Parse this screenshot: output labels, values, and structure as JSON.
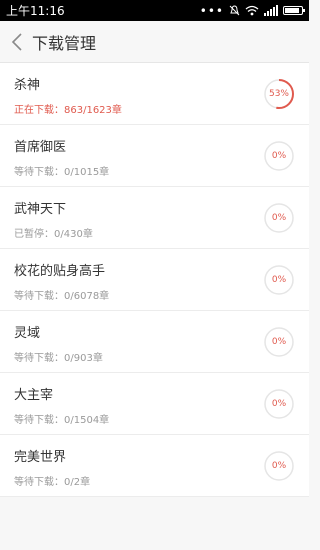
{
  "status_bar": {
    "time": "上午11:16",
    "icons": [
      "dots-icon",
      "mute-icon",
      "wifi-icon",
      "signal-icon",
      "battery-icon"
    ]
  },
  "header": {
    "back_icon": "chevron-left-icon",
    "title": "下载管理"
  },
  "downloads": [
    {
      "name": "杀神",
      "status": "正在下载：863/1623章",
      "percent": "53%",
      "progress": 0.53,
      "active": true
    },
    {
      "name": "首席御医",
      "status": "等待下载：0/1015章",
      "percent": "0%",
      "progress": 0,
      "active": false
    },
    {
      "name": "武神天下",
      "status": "已暂停：0/430章",
      "percent": "0%",
      "progress": 0,
      "active": false
    },
    {
      "name": "校花的贴身高手",
      "status": "等待下载：0/6078章",
      "percent": "0%",
      "progress": 0,
      "active": false
    },
    {
      "name": "灵域",
      "status": "等待下载：0/903章",
      "percent": "0%",
      "progress": 0,
      "active": false
    },
    {
      "name": "大主宰",
      "status": "等待下载：0/1504章",
      "percent": "0%",
      "progress": 0,
      "active": false
    },
    {
      "name": "完美世界",
      "status": "等待下载：0/2章",
      "percent": "0%",
      "progress": 0,
      "active": false
    }
  ],
  "colors": {
    "accent": "#e05a4e",
    "track": "#e5e5e5",
    "muted_text": "#9a9a9a"
  }
}
